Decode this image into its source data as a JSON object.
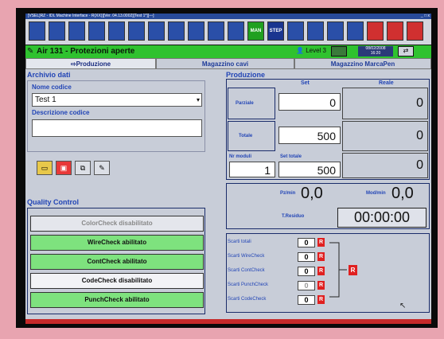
{
  "window": {
    "title": "[VSEL]RZ - IDL Machine Interface - R(XX)][Ver. 04.13.0002][Test 1*][---]",
    "controls": "_ □ x"
  },
  "toolbar": {
    "buttons": [
      {
        "icon": "save-icon",
        "color": "#2a4fa8",
        "label": ""
      },
      {
        "icon": "grid-icon",
        "color": "#2a4fa8",
        "label": ""
      },
      {
        "icon": "chart-icon",
        "color": "#2a4fa8",
        "label": ""
      },
      {
        "icon": "tools-icon",
        "color": "#2a4fa8",
        "label": ""
      },
      {
        "icon": "table-icon",
        "color": "#2a4fa8",
        "label": ""
      },
      {
        "icon": "list-icon",
        "color": "#2a4fa8",
        "label": ""
      },
      {
        "icon": "monitor-icon",
        "color": "#2a4fa8",
        "label": ""
      },
      {
        "icon": "printer-icon",
        "color": "#2a4fa8",
        "label": ""
      },
      {
        "icon": "book-icon",
        "color": "#2a4fa8",
        "label": ""
      },
      {
        "icon": "network-icon",
        "color": "#2a4fa8",
        "label": ""
      },
      {
        "icon": "camera-icon",
        "color": "#2a4fa8",
        "label": ""
      },
      {
        "icon": "man-icon",
        "color": "#20a020",
        "label": "MAN"
      },
      {
        "icon": "stop-icon",
        "color": "#1a3590",
        "label": "STEP"
      },
      {
        "icon": "doc-icon",
        "color": "#2a4fa8",
        "label": ""
      },
      {
        "icon": "ruler-icon",
        "color": "#2a4fa8",
        "label": ""
      },
      {
        "icon": "connector-icon",
        "color": "#2a4fa8",
        "label": ""
      },
      {
        "icon": "wire-icon",
        "color": "#2a4fa8",
        "label": ""
      },
      {
        "icon": "crimp-icon",
        "color": "#d03030",
        "label": ""
      },
      {
        "icon": "terminal-icon",
        "color": "#d03030",
        "label": ""
      },
      {
        "icon": "crimp2-icon",
        "color": "#d03030",
        "label": ""
      }
    ]
  },
  "status": {
    "title": "Air 131 - Protezioni aperte",
    "level": "Level 3",
    "date": "08/02/2008",
    "time": "16:20"
  },
  "tabs": {
    "production": "Produzione",
    "cables": "Magazzino cavi",
    "marcapen": "Magazzino MarcaPen"
  },
  "archivio": {
    "heading": "Archivio dati",
    "name_label": "Nome codice",
    "name_value": "Test 1",
    "desc_label": "Descrizione codice",
    "desc_value": ""
  },
  "quality": {
    "heading": "Quality Control",
    "items": [
      {
        "label": "ColorCheck disabilitato",
        "state": "disabled"
      },
      {
        "label": "WireCheck abilitato",
        "state": "enabled"
      },
      {
        "label": "ContCheck abilitato",
        "state": "enabled"
      },
      {
        "label": "CodeCheck disabilitato",
        "state": "disabled"
      },
      {
        "label": "PunchCheck abilitato",
        "state": "enabled"
      }
    ]
  },
  "produzione": {
    "heading": "Produzione",
    "col_set": "Set",
    "col_reale": "Reale",
    "parziale_label": "Parziale",
    "parziale_set": "0",
    "parziale_reale": "0",
    "totale_label": "Totale",
    "totale_set": "500",
    "totale_reale": "0",
    "nr_moduli_label": "Nr moduli",
    "nr_moduli": "1",
    "set_totale_label": "Set totale",
    "set_totale": "500",
    "set_totale_reale": "0"
  },
  "rates": {
    "pz_label": "Pz/min",
    "pz": "0,0",
    "mod_label": "Mod/min",
    "mod": "0,0",
    "residuo_label": "T.Residuo",
    "residuo": "00:00:00"
  },
  "scarti": {
    "items": [
      {
        "label": "Scarti totali",
        "value": "0"
      },
      {
        "label": "Scarti WireCheck",
        "value": "0"
      },
      {
        "label": "Scarti ContCheck",
        "value": "0"
      },
      {
        "label": "Scarti PunchCheck",
        "value": "0"
      },
      {
        "label": "Scarti CodeCheck",
        "value": "0"
      }
    ],
    "reset": "R"
  }
}
